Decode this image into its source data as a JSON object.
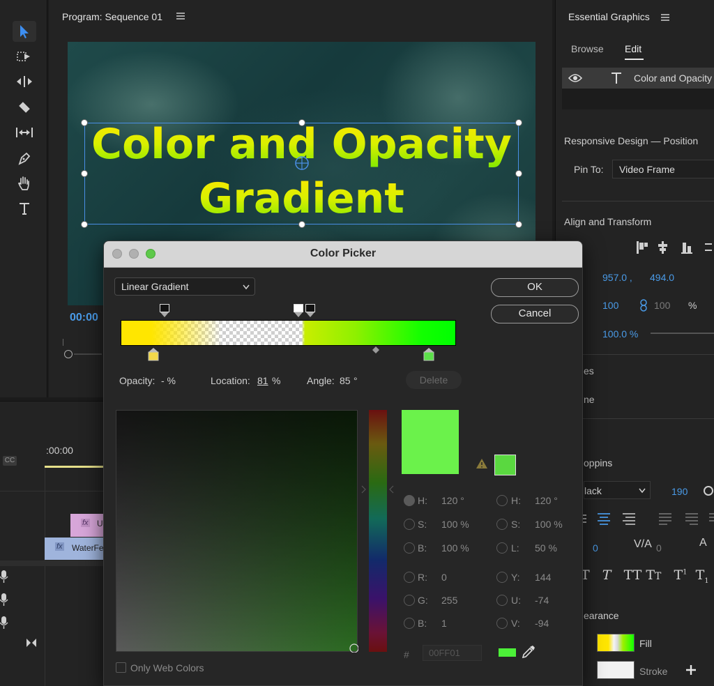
{
  "program": {
    "title": "Program: Sequence 01",
    "timecode": "00:00"
  },
  "video": {
    "title_line1": "Color and Opacity",
    "title_line2": "Gradient"
  },
  "essential_graphics": {
    "title": "Essential Graphics",
    "tabs": {
      "browse": "Browse",
      "edit": "Edit"
    },
    "layer_name": "Color and Opacity",
    "responsive_design": "Responsive Design — Position",
    "pin_to_label": "Pin To:",
    "pin_to_value": "Video Frame",
    "align_transform": "Align and Transform",
    "position_x": "957.0 ,",
    "position_y": "494.0",
    "scale": "100",
    "scale_h": "100",
    "scale_unit": "%",
    "opacity": "100.0 %",
    "styles_partial": "es",
    "none_partial": "ne",
    "font_partial": "oppins",
    "weight_partial": "lack",
    "font_size": "190",
    "tracking": "0",
    "kerning": "0",
    "appearance_partial": "earance",
    "fill": "Fill",
    "stroke": "Stroke"
  },
  "timeline": {
    "timecode": ":00:00",
    "cc": "CC",
    "clip_top": "U",
    "clip_bottom": "WaterFe",
    "fx": "fx"
  },
  "color_picker": {
    "title": "Color Picker",
    "mode": "Linear Gradient",
    "ok": "OK",
    "cancel": "Cancel",
    "opacity_label": "Opacity:",
    "opacity_value": "- %",
    "location_label": "Location:",
    "location_value": "81",
    "location_unit": "%",
    "angle_label": "Angle:",
    "angle_value": "85",
    "angle_unit": "°",
    "delete": "Delete",
    "hsb": {
      "h": "120 °",
      "s": "100 %",
      "b": "100 %"
    },
    "hsl": {
      "h": "120 °",
      "s": "100 %",
      "l": "50 %"
    },
    "rgb": {
      "r": "0",
      "g": "255",
      "b": "1"
    },
    "yuv": {
      "y": "144",
      "u": "-74",
      "v": "-94"
    },
    "labels": {
      "h": "H:",
      "s": "S:",
      "b": "B:",
      "l": "L:",
      "r": "R:",
      "g": "G:",
      "y": "Y:",
      "u": "U:",
      "v": "V:"
    },
    "hash": "#",
    "hex": "00FF01",
    "only_web_colors": "Only Web Colors",
    "colors": {
      "current": "#6bf24b",
      "previous": "#5ad840",
      "swatch": "#4cf038"
    }
  }
}
